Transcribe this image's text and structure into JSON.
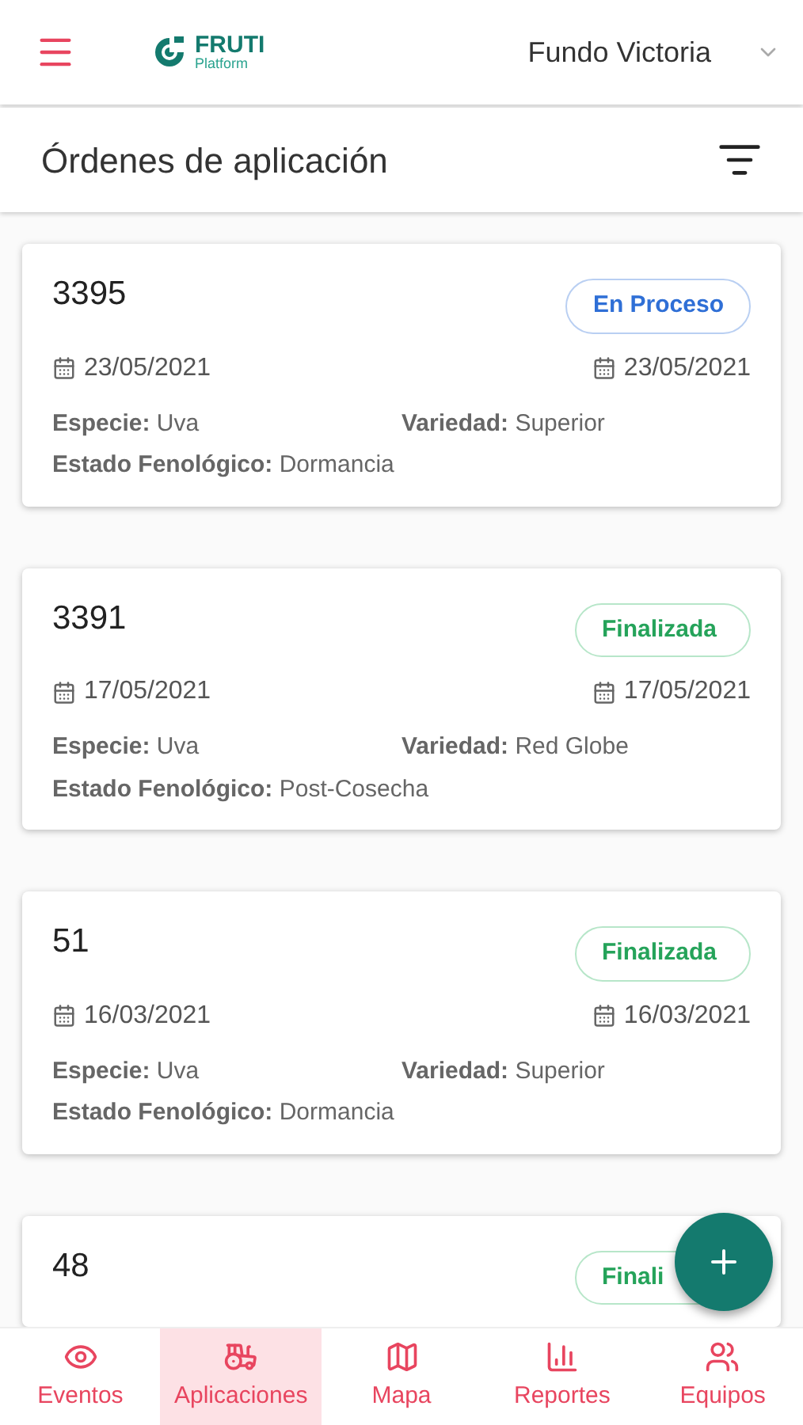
{
  "header": {
    "brand": "FRUTI",
    "brand_sub": "Platform",
    "farm": "Fundo Victoria"
  },
  "title": "Órdenes de aplicación",
  "orders": [
    {
      "number": "3395",
      "status": {
        "kind": "in_progress",
        "label": "En Proceso"
      },
      "start_date": "23/05/2021",
      "end_date": "23/05/2021",
      "fields": [
        {
          "label": "Especie:",
          "value": "Uva"
        },
        {
          "label": "Variedad:",
          "value": "Superior"
        },
        {
          "label": "Estado Fenológico:",
          "value": "Dormancia"
        }
      ]
    },
    {
      "number": "3391",
      "status": {
        "kind": "done",
        "label": "Finalizada"
      },
      "start_date": "17/05/2021",
      "end_date": "17/05/2021",
      "fields": [
        {
          "label": "Especie:",
          "value": "Uva"
        },
        {
          "label": "Variedad:",
          "value": "Red Globe"
        },
        {
          "label": "Estado Fenológico:",
          "value": "Post-Cosecha"
        }
      ]
    },
    {
      "number": "51",
      "status": {
        "kind": "done",
        "label": "Finalizada"
      },
      "start_date": "16/03/2021",
      "end_date": "16/03/2021",
      "fields": [
        {
          "label": "Especie:",
          "value": "Uva"
        },
        {
          "label": "Variedad:",
          "value": "Superior"
        },
        {
          "label": "Estado Fenológico:",
          "value": "Dormancia"
        }
      ]
    },
    {
      "number": "48",
      "status": {
        "kind": "done",
        "label": "Finali"
      }
    }
  ],
  "nav": [
    {
      "kind": "events",
      "label": "Eventos",
      "selected": false
    },
    {
      "kind": "applications",
      "label": "Aplicaciones",
      "selected": true
    },
    {
      "kind": "map",
      "label": "Mapa",
      "selected": false
    },
    {
      "kind": "reports",
      "label": "Reportes",
      "selected": false
    },
    {
      "kind": "teams",
      "label": "Equipos",
      "selected": false
    }
  ]
}
